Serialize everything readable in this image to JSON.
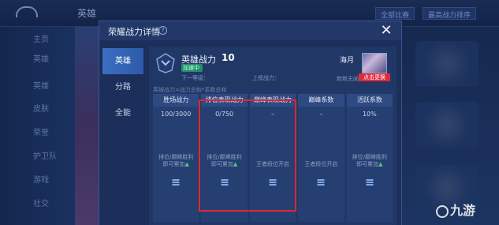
{
  "background": {
    "header_title": "英雄",
    "filter_label": "全部比赛",
    "sort_label": "最高战力排序",
    "side_menu": [
      "主页",
      "英雄",
      "英雄",
      "皮肤",
      "荣誉",
      "护卫队",
      "游戏",
      "社交"
    ]
  },
  "modal": {
    "title": "荣耀战力详情",
    "close_symbol": "✕",
    "tabs": [
      "英雄",
      "分路",
      "全能"
    ],
    "active_tab": "英雄",
    "hero_power_label": "英雄战力",
    "hero_power_value": "10",
    "speed_badge": "加速中",
    "next_tier_label": "下一等级：",
    "top_list_label": "上榜战力：",
    "player_name": "海月",
    "default_display": "默默无闻",
    "change_button": "点击更换",
    "formula": "英雄战力=战力总和*系数总和",
    "columns": [
      {
        "header": "胜场战力",
        "value": "100/3000",
        "note_lines": [
          "排位/巅峰胜利",
          "即可累加"
        ],
        "arrow": true
      },
      {
        "header": "排位表现战力",
        "value": "0/750",
        "note_lines": [
          "排位/巅峰胜利",
          "即可累加"
        ],
        "arrow": true
      },
      {
        "header": "巅峰表现战力",
        "value": "–",
        "note_lines": [
          "王者段位开启"
        ],
        "arrow": false
      },
      {
        "header": "巅峰系数",
        "value": "–",
        "note_lines": [
          "王者段位开启"
        ],
        "arrow": false
      },
      {
        "header": "活跃系数",
        "value": "10%",
        "note_lines": [
          "排位/巅峰胜利",
          "即可累加"
        ],
        "arrow": true
      }
    ]
  },
  "watermark": "九游",
  "colors": {
    "highlight": "#e0262e",
    "active_tab": "#3c6fc4",
    "speed_badge": "#1f8f6a",
    "change_button": "#e02b3a"
  }
}
